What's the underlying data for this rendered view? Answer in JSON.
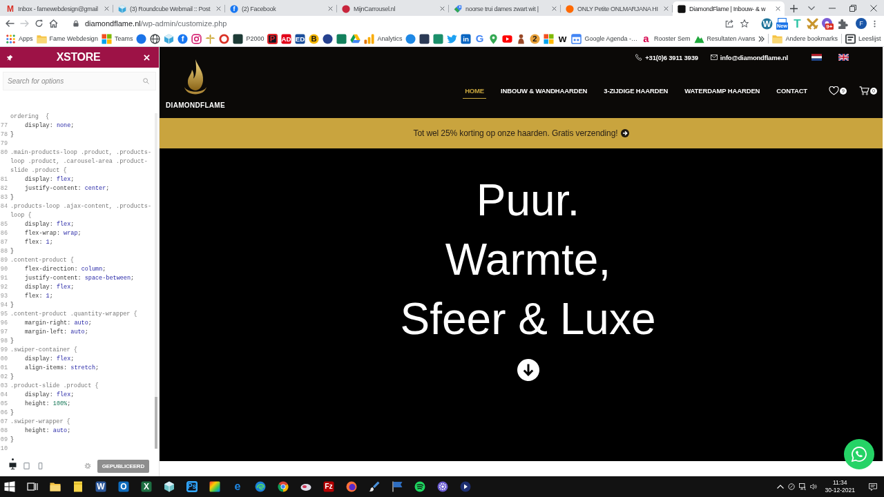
{
  "tabs": [
    {
      "title": "Inbox - famewebdesign@gmail",
      "selected": false,
      "favicon": {
        "kind": "letter",
        "color": "#d93025",
        "glyph": "M"
      }
    },
    {
      "title": "(3) Roundcube Webmail :: Post",
      "selected": false,
      "favicon": {
        "kind": "cube",
        "color": "#3aa6d9"
      }
    },
    {
      "title": "(2) Facebook",
      "selected": false,
      "favicon": {
        "kind": "disc",
        "color": "#1877f2",
        "glyph": "f"
      }
    },
    {
      "title": "MijnCarrousel.nl",
      "selected": false,
      "favicon": {
        "kind": "disc",
        "color": "#c8253c"
      }
    },
    {
      "title": "noorse trui dames zwart wit |",
      "selected": false,
      "favicon": {
        "kind": "tag",
        "color": "#4285f4"
      }
    },
    {
      "title": "ONLY Petite ONLMARJANA HI",
      "selected": false,
      "favicon": {
        "kind": "disc",
        "color": "#ff6900"
      }
    },
    {
      "title": "DiamondFlame | Inbouw- & w",
      "selected": true,
      "favicon": {
        "kind": "tile",
        "color": "#111111"
      }
    }
  ],
  "address": {
    "host": "diamondflame.nl",
    "path": "/wp-admin/customize.php"
  },
  "extensions": [
    {
      "kind": "disc",
      "color": "#21759b",
      "glyph": "W"
    },
    {
      "kind": "newtile",
      "color": "#1a73e8",
      "glyph": "New"
    },
    {
      "kind": "letter",
      "color": "#2ec4a6",
      "glyph": "T"
    },
    {
      "kind": "swords",
      "color": "#c8962e"
    },
    {
      "kind": "burst",
      "color": "#7b5cd6",
      "glyph": "9+"
    },
    {
      "kind": "puzzle",
      "color": "#5f6368"
    }
  ],
  "profile": {
    "initial": "F"
  },
  "bookmarks": [
    {
      "kind": "grid",
      "label": "Apps"
    },
    {
      "kind": "folder",
      "label": "Fame Webdesign"
    },
    {
      "kind": "squares",
      "label": "Teams"
    },
    {
      "kind": "disc",
      "color": "#1a73e8"
    },
    {
      "kind": "globe",
      "color": "#3c4043"
    },
    {
      "kind": "cube",
      "color": "#3aa6d9"
    },
    {
      "kind": "disc",
      "color": "#1877f2",
      "glyph": "f"
    },
    {
      "kind": "camera",
      "color": "#d62976"
    },
    {
      "kind": "fleur",
      "color": "#c9a227"
    },
    {
      "kind": "ring",
      "color": "#d93025"
    },
    {
      "kind": "tile",
      "color": "#1d3b36",
      "label": "P2000"
    },
    {
      "kind": "frame",
      "color": "#e5262b",
      "glyph": "P"
    },
    {
      "kind": "tile",
      "color": "#e2001a",
      "glyph": "AD"
    },
    {
      "kind": "tile",
      "color": "#1b4f9c",
      "glyph": "ED"
    },
    {
      "kind": "disc",
      "color": "#f5b700",
      "glyph": "B"
    },
    {
      "kind": "disc",
      "color": "#26418f"
    },
    {
      "kind": "tile",
      "color": "#12805c"
    },
    {
      "kind": "triangle"
    },
    {
      "kind": "bars",
      "label": "Analytics"
    },
    {
      "kind": "disc",
      "color": "#1e88e5"
    },
    {
      "kind": "tile",
      "color": "#2b3a55"
    },
    {
      "kind": "tile",
      "color": "#1b8f6a"
    },
    {
      "kind": "bird",
      "color": "#1da1f2"
    },
    {
      "kind": "tile",
      "color": "#0a66c2",
      "glyph": "in"
    },
    {
      "kind": "letter",
      "color": "#4285f4",
      "glyph": "G"
    },
    {
      "kind": "pin",
      "color": "#34a853"
    },
    {
      "kind": "play",
      "color": "#ff0000"
    },
    {
      "kind": "figure",
      "color": "#9a4a28"
    },
    {
      "kind": "disc",
      "color": "#e9a23b",
      "glyph": "2"
    },
    {
      "kind": "squares"
    },
    {
      "kind": "letter",
      "color": "#111111",
      "glyph": "w"
    },
    {
      "kind": "calendar",
      "color": "#4285f4",
      "label": "Google Agenda -…"
    },
    {
      "kind": "letter",
      "color": "#d5004b",
      "glyph": "a",
      "label": "Rooster Sem"
    },
    {
      "kind": "hill",
      "color": "#1fa83c",
      "label": "Resultaten Avans"
    }
  ],
  "other_bookmarks": {
    "kind": "folder",
    "label": "Andere bookmarks"
  },
  "reading_list": {
    "kind": "list",
    "color": "#3c4043",
    "label": "Leeslijst"
  },
  "customizer": {
    "brand": "XSTORE",
    "search": {
      "placeholder": "Search for options"
    },
    "code_lines": [
      {
        "kind": "rule",
        "segments": [
          {
            "kind": "selector",
            "text": "ordering  {"
          }
        ]
      },
      {
        "kind": "decl",
        "number": "77",
        "segments": [
          {
            "kind": "plain",
            "text": "display: "
          },
          {
            "kind": "keyword",
            "text": "none"
          },
          {
            "kind": "plain",
            "text": ";"
          }
        ]
      },
      {
        "kind": "rule",
        "number": "78",
        "segments": [
          {
            "kind": "plain",
            "text": "}"
          }
        ]
      },
      {
        "kind": "blank",
        "number": "79"
      },
      {
        "kind": "rule",
        "number": "80",
        "segments": [
          {
            "kind": "selector",
            "text": ".main-products-loop .product, .products-"
          }
        ]
      },
      {
        "kind": "rule",
        "segments": [
          {
            "kind": "selector",
            "text": "loop .product, .carousel-area .product-"
          }
        ]
      },
      {
        "kind": "rule",
        "segments": [
          {
            "kind": "selector",
            "text": "slide .product {"
          }
        ]
      },
      {
        "kind": "decl",
        "number": "81",
        "segments": [
          {
            "kind": "plain",
            "text": "display: "
          },
          {
            "kind": "keyword",
            "text": "flex"
          },
          {
            "kind": "plain",
            "text": ";"
          }
        ]
      },
      {
        "kind": "decl",
        "number": "82",
        "segments": [
          {
            "kind": "plain",
            "text": "justify-content: "
          },
          {
            "kind": "keyword",
            "text": "center"
          },
          {
            "kind": "plain",
            "text": ";"
          }
        ]
      },
      {
        "kind": "rule",
        "number": "83",
        "segments": [
          {
            "kind": "plain",
            "text": "}"
          }
        ]
      },
      {
        "kind": "rule",
        "number": "84",
        "segments": [
          {
            "kind": "selector",
            "text": ".products-loop .ajax-content, .products-"
          }
        ]
      },
      {
        "kind": "rule",
        "segments": [
          {
            "kind": "selector",
            "text": "loop {"
          }
        ]
      },
      {
        "kind": "decl",
        "number": "85",
        "segments": [
          {
            "kind": "plain",
            "text": "display: "
          },
          {
            "kind": "keyword",
            "text": "flex"
          },
          {
            "kind": "plain",
            "text": ";"
          }
        ]
      },
      {
        "kind": "decl",
        "number": "86",
        "segments": [
          {
            "kind": "plain",
            "text": "flex-wrap: "
          },
          {
            "kind": "keyword",
            "text": "wrap"
          },
          {
            "kind": "plain",
            "text": ";"
          }
        ]
      },
      {
        "kind": "decl",
        "number": "87",
        "segments": [
          {
            "kind": "plain",
            "text": "flex: "
          },
          {
            "kind": "keyword",
            "text": "1"
          },
          {
            "kind": "plain",
            "text": ";"
          }
        ]
      },
      {
        "kind": "rule",
        "number": "88",
        "segments": [
          {
            "kind": "plain",
            "text": "}"
          }
        ]
      },
      {
        "kind": "rule",
        "number": "89",
        "segments": [
          {
            "kind": "selector",
            "text": ".content-product {"
          }
        ]
      },
      {
        "kind": "decl",
        "number": "90",
        "segments": [
          {
            "kind": "plain",
            "text": "flex-direction: "
          },
          {
            "kind": "keyword",
            "text": "column"
          },
          {
            "kind": "plain",
            "text": ";"
          }
        ]
      },
      {
        "kind": "decl",
        "number": "91",
        "segments": [
          {
            "kind": "plain",
            "text": "justify-content: "
          },
          {
            "kind": "keyword",
            "text": "space-between"
          },
          {
            "kind": "plain",
            "text": ";"
          }
        ]
      },
      {
        "kind": "decl",
        "number": "92",
        "segments": [
          {
            "kind": "plain",
            "text": "display: "
          },
          {
            "kind": "keyword",
            "text": "flex"
          },
          {
            "kind": "plain",
            "text": ";"
          }
        ]
      },
      {
        "kind": "decl",
        "number": "93",
        "segments": [
          {
            "kind": "plain",
            "text": "flex: "
          },
          {
            "kind": "keyword",
            "text": "1"
          },
          {
            "kind": "plain",
            "text": ";"
          }
        ]
      },
      {
        "kind": "rule",
        "number": "94",
        "segments": [
          {
            "kind": "plain",
            "text": "}"
          }
        ]
      },
      {
        "kind": "rule",
        "number": "95",
        "segments": [
          {
            "kind": "selector",
            "text": ".content-product .quantity-wrapper {"
          }
        ]
      },
      {
        "kind": "decl",
        "number": "96",
        "segments": [
          {
            "kind": "plain",
            "text": "margin-right: "
          },
          {
            "kind": "keyword",
            "text": "auto"
          },
          {
            "kind": "plain",
            "text": ";"
          }
        ]
      },
      {
        "kind": "decl",
        "number": "97",
        "segments": [
          {
            "kind": "plain",
            "text": "margin-left: "
          },
          {
            "kind": "keyword",
            "text": "auto"
          },
          {
            "kind": "plain",
            "text": ";"
          }
        ]
      },
      {
        "kind": "rule",
        "number": "98",
        "segments": [
          {
            "kind": "plain",
            "text": "}"
          }
        ]
      },
      {
        "kind": "rule",
        "number": "99",
        "segments": [
          {
            "kind": "selector",
            "text": ".swiper-container {"
          }
        ]
      },
      {
        "kind": "decl",
        "number": "00",
        "segments": [
          {
            "kind": "plain",
            "text": "display: "
          },
          {
            "kind": "keyword",
            "text": "flex"
          },
          {
            "kind": "plain",
            "text": ";"
          }
        ]
      },
      {
        "kind": "decl",
        "number": "01",
        "segments": [
          {
            "kind": "plain",
            "text": "align-items: "
          },
          {
            "kind": "keyword",
            "text": "stretch"
          },
          {
            "kind": "plain",
            "text": ";"
          }
        ]
      },
      {
        "kind": "rule",
        "number": "02",
        "segments": [
          {
            "kind": "plain",
            "text": "}"
          }
        ]
      },
      {
        "kind": "rule",
        "number": "03",
        "segments": [
          {
            "kind": "selector",
            "text": ".product-slide .product {"
          }
        ]
      },
      {
        "kind": "decl",
        "number": "04",
        "segments": [
          {
            "kind": "plain",
            "text": "display: "
          },
          {
            "kind": "keyword",
            "text": "flex"
          },
          {
            "kind": "plain",
            "text": ";"
          }
        ]
      },
      {
        "kind": "decl",
        "number": "05",
        "segments": [
          {
            "kind": "plain",
            "text": "height: "
          },
          {
            "kind": "number",
            "text": "100%"
          },
          {
            "kind": "plain",
            "text": ";"
          }
        ]
      },
      {
        "kind": "rule",
        "number": "06",
        "segments": [
          {
            "kind": "plain",
            "text": "}"
          }
        ]
      },
      {
        "kind": "rule",
        "number": "07",
        "segments": [
          {
            "kind": "selector",
            "text": ".swiper-wrapper {"
          }
        ]
      },
      {
        "kind": "decl",
        "number": "08",
        "segments": [
          {
            "kind": "plain",
            "text": "height: "
          },
          {
            "kind": "keyword",
            "text": "auto"
          },
          {
            "kind": "plain",
            "text": ";"
          }
        ]
      },
      {
        "kind": "rule",
        "number": "09",
        "segments": [
          {
            "kind": "plain",
            "text": "}"
          }
        ]
      },
      {
        "kind": "blank",
        "number": "10"
      }
    ],
    "devices": [
      {
        "kind": "desktop",
        "selected": true
      },
      {
        "kind": "tablet",
        "selected": false
      },
      {
        "kind": "mobile",
        "selected": false
      }
    ],
    "publish_button": {
      "label": "GEPUBLICEERD",
      "disabled": true
    }
  },
  "site": {
    "phone": "+31(0)6 3911 3939",
    "email": "info@diamondflame.nl",
    "languages": [
      {
        "kind": "nl"
      },
      {
        "kind": "en"
      }
    ],
    "logo_text": "DIAMONDFLAME",
    "nav": [
      {
        "label": "HOME",
        "selected": true
      },
      {
        "label": "INBOUW & WANDHAARDEN",
        "selected": false
      },
      {
        "label": "3-ZIJDIGE HAARDEN",
        "selected": false
      },
      {
        "label": "WATERDAMP HAARDEN",
        "selected": false
      },
      {
        "label": "CONTACT",
        "selected": false
      }
    ],
    "wishlist_count": "9",
    "cart_count": "0",
    "promo": "Tot wel 25% korting op onze haarden. Gratis verzending!",
    "hero_title": [
      "Puur.",
      "Warmte,",
      "Sfeer & Luxe"
    ]
  },
  "taskbar": {
    "apps": [
      {
        "kind": "windows"
      },
      {
        "kind": "taskview"
      },
      {
        "kind": "folder"
      },
      {
        "kind": "note",
        "color": "#f7d548"
      },
      {
        "kind": "tile",
        "color": "#2b579a",
        "glyph": "W"
      },
      {
        "kind": "tile",
        "color": "#0f6cbd",
        "glyph": "O"
      },
      {
        "kind": "tile",
        "color": "#1d6f42",
        "glyph": "X"
      },
      {
        "kind": "cube",
        "color": "#6fc3c8"
      },
      {
        "kind": "frame",
        "color": "#31a8ff",
        "glyph": "Ps"
      },
      {
        "kind": "gradient"
      },
      {
        "kind": "letter",
        "color": "#1e88e5",
        "glyph": "e"
      },
      {
        "kind": "swirl",
        "color": "#1b7fd6"
      },
      {
        "kind": "chrome"
      },
      {
        "kind": "blob",
        "color": "#dcdce8"
      },
      {
        "kind": "tile",
        "color": "#b40000",
        "glyph": "Fz"
      },
      {
        "kind": "fox"
      },
      {
        "kind": "brush"
      },
      {
        "kind": "flag",
        "color": "#2f6ec0"
      },
      {
        "kind": "waves",
        "color": "#1ed760"
      },
      {
        "kind": "gear",
        "color": "#6a5bd0"
      },
      {
        "kind": "arrowdisc",
        "color": "#1d2e70"
      }
    ],
    "clock": {
      "time": "11:34",
      "date": "30-12-2021"
    }
  }
}
